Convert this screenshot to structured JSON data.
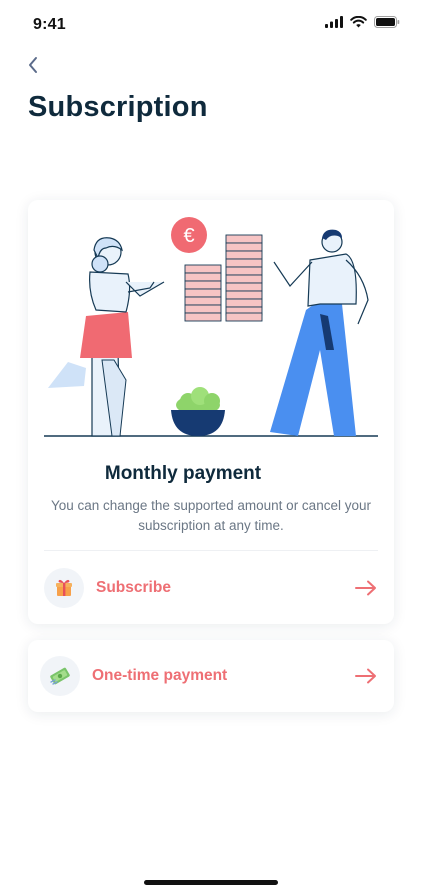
{
  "status_bar": {
    "time": "9:41"
  },
  "header": {
    "title": "Subscription"
  },
  "main_card": {
    "heading": "Monthly payment",
    "description": "You can change the supported amount or cancel your subscription at any time.",
    "subscribe_label": "Subscribe",
    "currency_symbol": "€"
  },
  "second_card": {
    "label": "One-time payment"
  },
  "colors": {
    "accent": "#ee6f74",
    "title": "#0f2a3c",
    "blue": "#4a8ff0",
    "navy": "#163a72"
  },
  "icons": {
    "back": "chevron-left-icon",
    "subscribe": "gift-icon",
    "onetime": "money-icon",
    "arrow": "arrow-right-icon"
  }
}
